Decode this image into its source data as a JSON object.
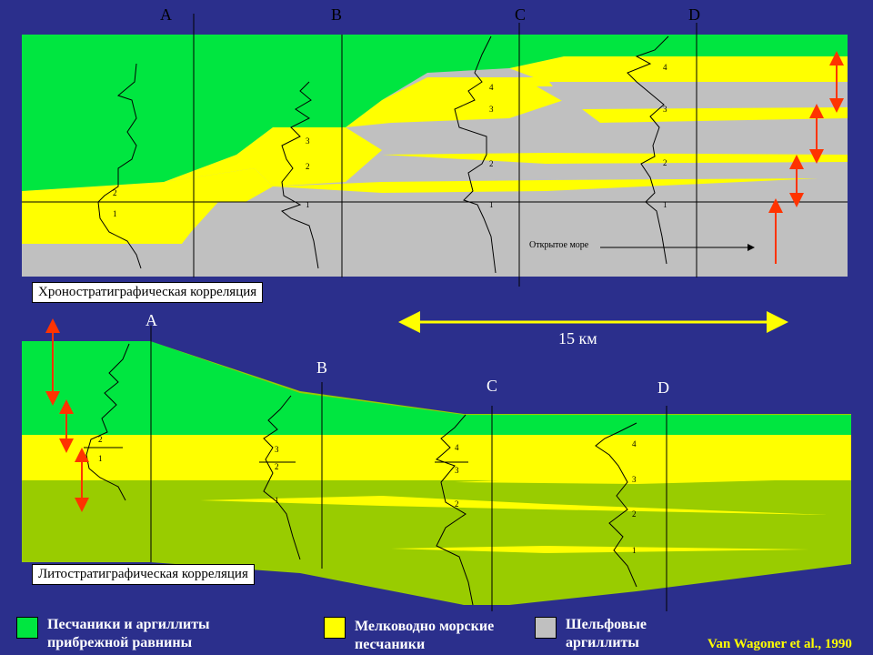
{
  "upper_panel": {
    "wells": [
      "A",
      "B",
      "C",
      "D"
    ],
    "title": "Хроностратиграфическая корреляция",
    "annotation": "Открытое море",
    "well_markers": {
      "A": [
        "2",
        "1"
      ],
      "B": [
        "3",
        "2",
        "1"
      ],
      "C": [
        "4",
        "3",
        "2",
        "1"
      ],
      "D": [
        "4",
        "3",
        "2",
        "1"
      ]
    }
  },
  "lower_panel": {
    "wells": [
      "A",
      "B",
      "C",
      "D"
    ],
    "title": "Литостратиграфическая корреляция",
    "scale_label": "15 км",
    "well_markers": {
      "A": [
        "2",
        "1"
      ],
      "B": [
        "3",
        "2",
        "1"
      ],
      "C": [
        "4",
        "3",
        "2"
      ],
      "D": [
        "4",
        "3",
        "2",
        "1"
      ]
    }
  },
  "legend": [
    {
      "label": "Песчаники и аргиллиты прибрежной равнины",
      "color": "#00e640"
    },
    {
      "label": "Мелководно морские песчаники",
      "color": "#ffff00"
    },
    {
      "label": "Шельфовые аргиллиты",
      "color": "#c0c0c0"
    }
  ],
  "credit": "Van Wagoner et al., 1990",
  "colors": {
    "background": "#2b2f8c",
    "coastal": "#00e640",
    "shallow_sand": "#ffff00",
    "shelf": "#c0c0c0",
    "lito_shelf": "#99cc00",
    "arrow": "#ff3300",
    "scale_arrow": "#ffff00"
  }
}
